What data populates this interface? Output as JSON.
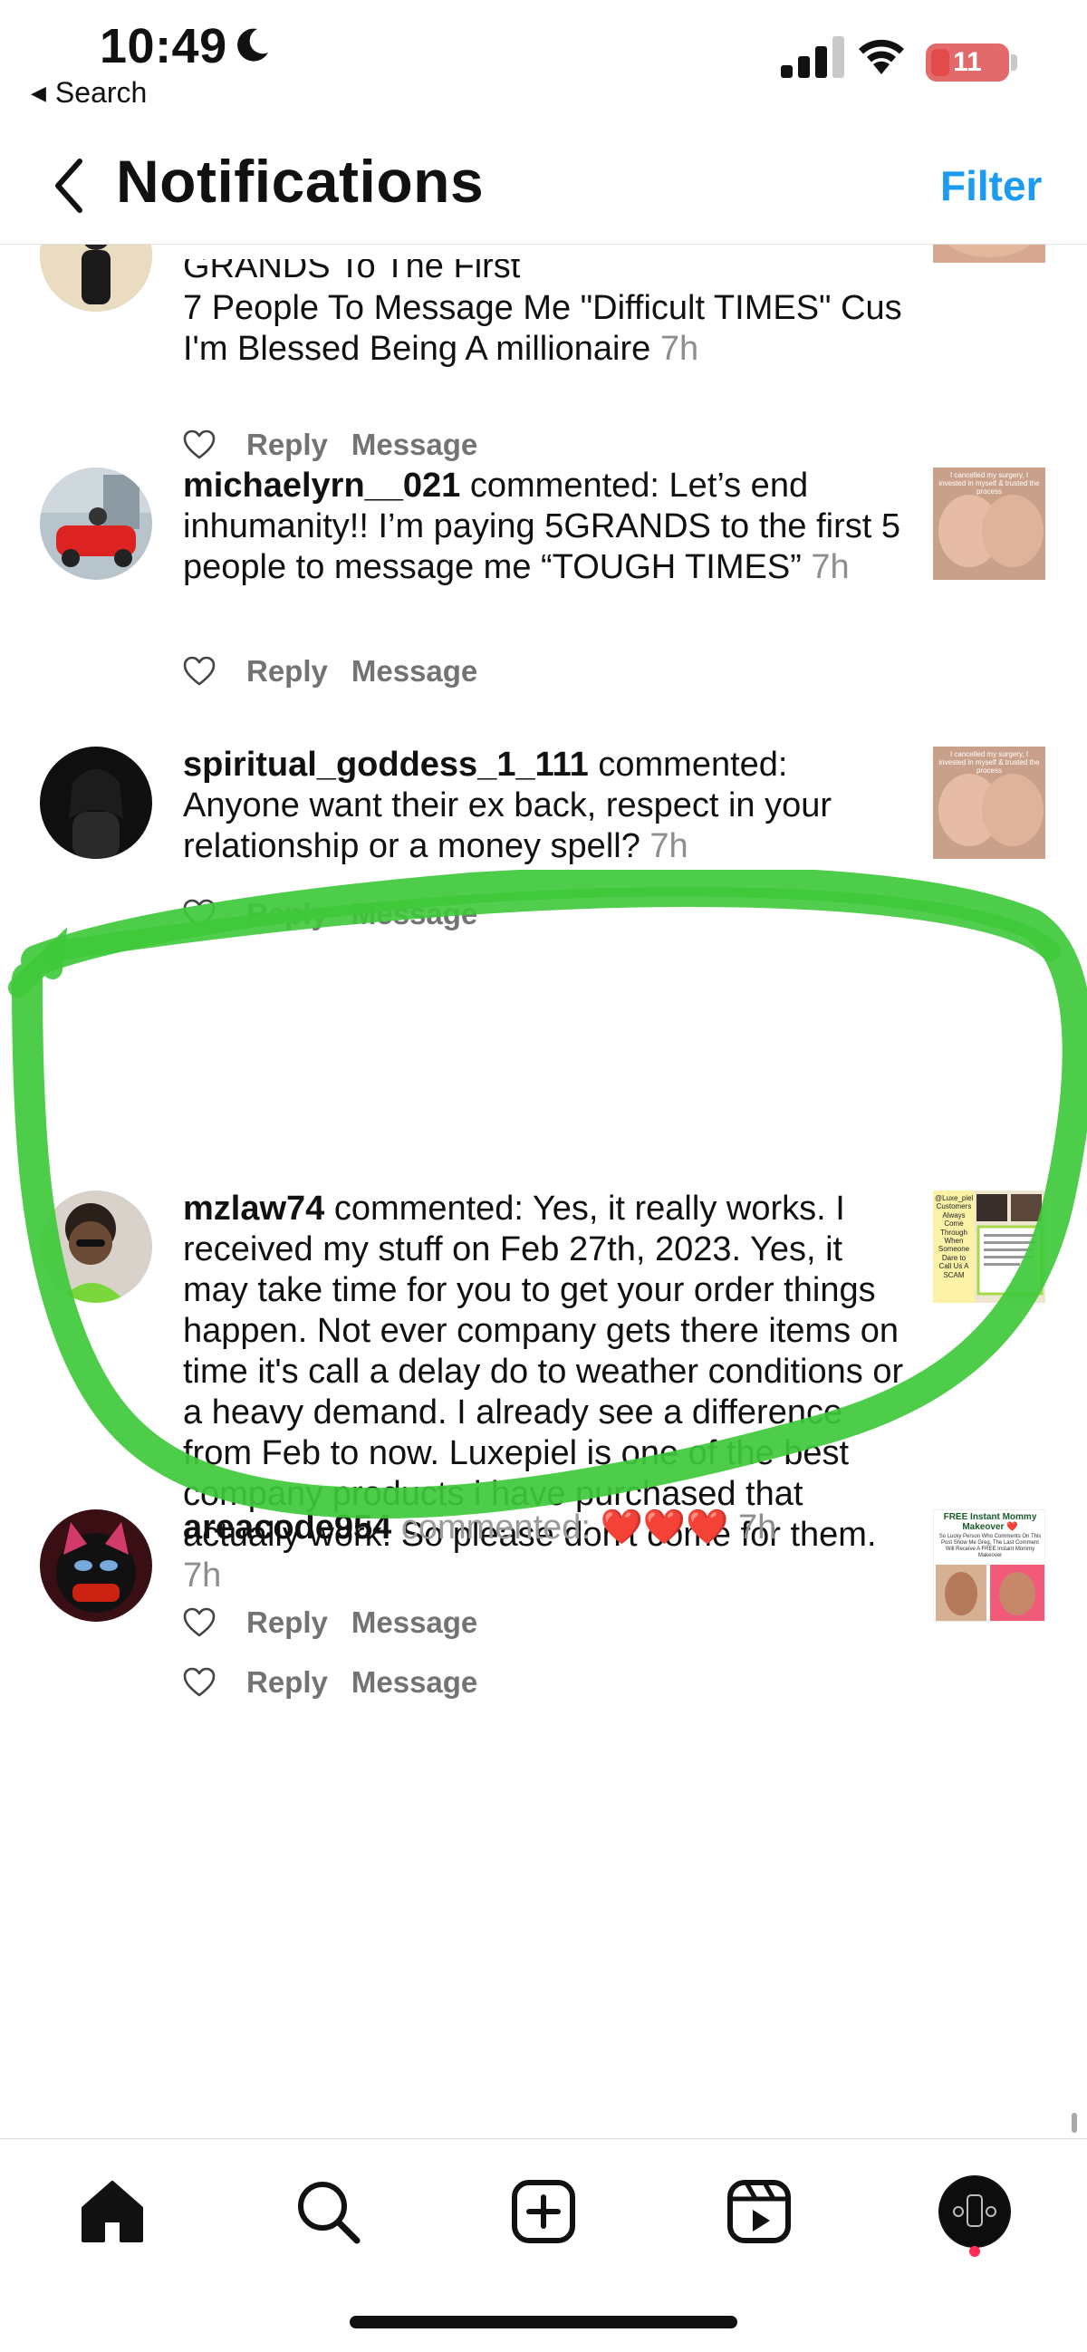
{
  "status_bar": {
    "time": "10:49",
    "back_app_label": "Search",
    "battery_level": "11"
  },
  "header": {
    "title": "Notifications",
    "filter_label": "Filter"
  },
  "notifications": [
    {
      "text_clipped": "GRANDS To The First",
      "text": "7 People To Message Me \"Difficult TIMES\" Cus I'm Blessed Being A millionaire",
      "time": "7h",
      "reply_label": "Reply",
      "message_label": "Message"
    },
    {
      "username": "michaelyrn__021",
      "action": "commented:",
      "text": "Let’s end inhumanity!! I’m paying 5GRANDS to the first 5 people to message me “TOUGH TIMES”",
      "time": "7h",
      "reply_label": "Reply",
      "message_label": "Message",
      "thumb_caption": "I cancelled my surgery, I invested in myself & trusted the process"
    },
    {
      "username": "spiritual_goddess_1_111",
      "action": "commented:",
      "text": "Anyone want their ex back, respect in your relationship or a money spell?",
      "time": "7h",
      "reply_label": "Reply",
      "message_label": "Message",
      "thumb_caption": "I cancelled my surgery, I invested in myself & trusted the process"
    },
    {
      "username": "mzlaw74",
      "action": "commented:",
      "text": "Yes, it really works. I received my stuff on Feb 27th, 2023. Yes, it may take time for you to get your order things happen. Not ever company gets there items on time it's call a delay do to weather conditions or a heavy demand. I already see a difference from Feb to now. Luxepiel is one of the best company products i have purchased that actually work. So please don't come for them.",
      "time": "7h",
      "reply_label": "Reply",
      "message_label": "Message",
      "thumb_caption": "@Luxe_piel Customers Always Come Through When Someone Dare to Call Us A SCAM"
    },
    {
      "username": "areacode954",
      "action": "commented:",
      "text": "❤️❤️❤️",
      "time": "7h",
      "reply_label": "Reply",
      "message_label": "Message",
      "thumb_title": "FREE Instant Mommy Makeover ❤️",
      "thumb_caption": "So Lucky Person Who Comments On This Post Show Me Greg, The Last Comment Will Receive A FREE Instant Mommy Makeover"
    }
  ],
  "colors": {
    "accent": "#1d9bf0",
    "annotation_green": "#3ec93a",
    "secondary_text": "#8e8e8e",
    "notification_dot": "#ff2d55"
  },
  "icons": {
    "back": "chevron-left-icon",
    "like": "heart-outline-icon",
    "home": "home-icon",
    "search": "search-icon",
    "create": "plus-square-icon",
    "reels": "reels-icon",
    "profile": "profile-avatar-icon"
  }
}
